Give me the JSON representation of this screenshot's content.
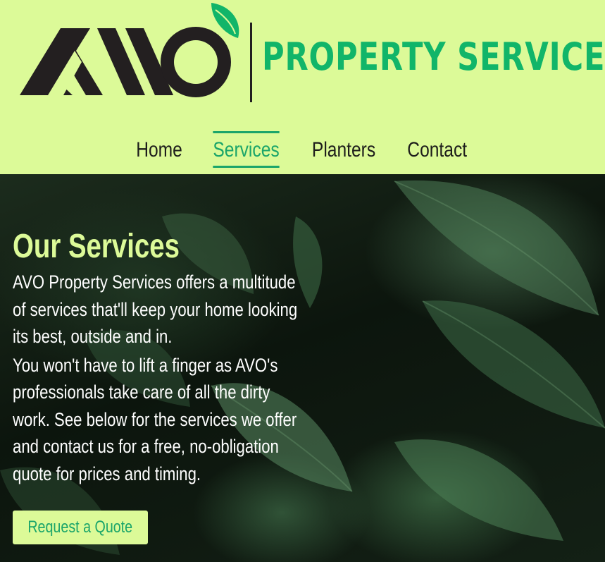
{
  "brand": {
    "logo_mark": "AVO",
    "name": "PROPERTY SERVICES",
    "logo_icon": "avocado-leaf-icon"
  },
  "nav": {
    "items": [
      {
        "label": "Home",
        "active": false
      },
      {
        "label": "Services",
        "active": true
      },
      {
        "label": "Planters",
        "active": false
      },
      {
        "label": "Contact",
        "active": false
      }
    ]
  },
  "hero": {
    "title": "Our Services",
    "paragraphs": [
      "AVO Property Services offers a multitude of services that'll keep your home looking its best, outside and in.",
      "You won't have to lift a finger as AVO's professionals take care of all the dirty work. See below for the services we offer and contact us for a free, no-obligation quote for prices and timing."
    ],
    "cta_label": "Request a Quote"
  },
  "colors": {
    "header_bg": "#dcfa98",
    "accent_green": "#1aa56a",
    "brand_green": "#11b569",
    "dark": "#231f20",
    "hero_text": "#ffffff"
  }
}
